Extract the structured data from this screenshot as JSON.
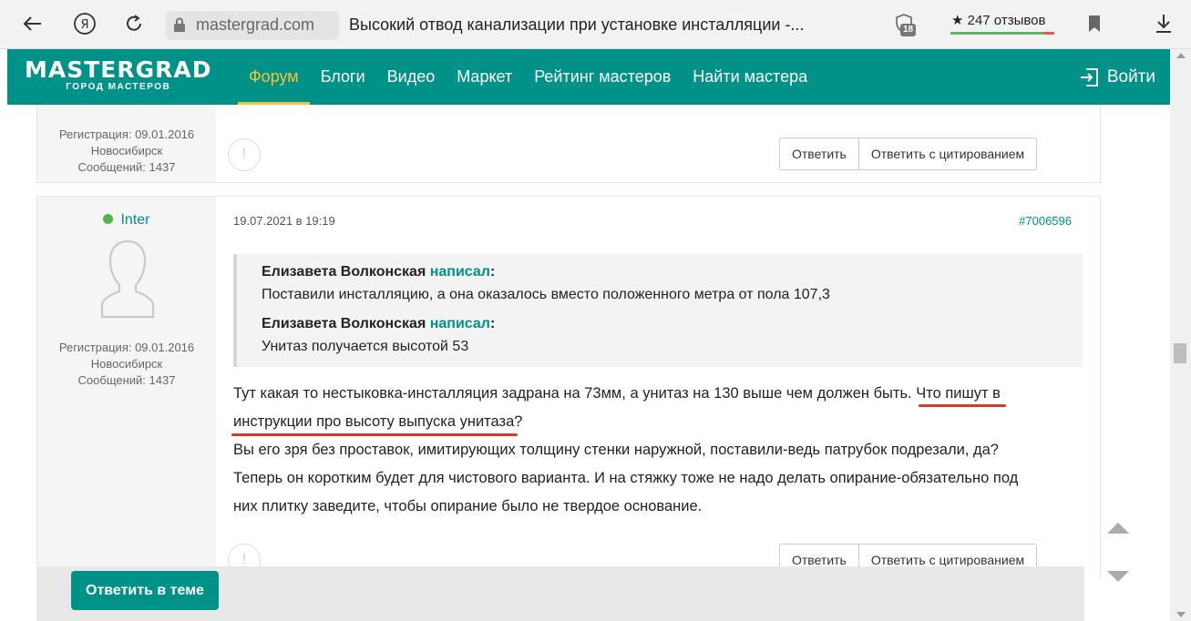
{
  "browser": {
    "domain": "mastergrad.com",
    "title": "Высокий отвод канализации при установке инсталляции -...",
    "shield_badge": "18",
    "reviews": "★ 247 отзывов"
  },
  "site": {
    "logo_main": "MASTERGRAD",
    "logo_sub": "ГОРОД МАСТЕРОВ",
    "nav": [
      "Форум",
      "Блоги",
      "Видео",
      "Маркет",
      "Рейтинг мастеров",
      "Найти мастера"
    ],
    "login": "Войти"
  },
  "prev_post": {
    "registration": "Регистрация: 09.01.2016",
    "city": "Новосибирск",
    "messages": "Сообщений: 1437",
    "reply": "Ответить",
    "reply_quote": "Ответить с цитированием"
  },
  "post": {
    "username": "Inter",
    "registration": "Регистрация: 09.01.2016",
    "city": "Новосибирск",
    "messages": "Сообщений: 1437",
    "date": "19.07.2021 в 19:19",
    "number": "#7006596",
    "quotes": [
      {
        "author": "Елизавета Волконская",
        "wrote": "написал",
        "colon": ":",
        "text": "Поставили инсталляцию, а она оказалось вместо положенного метра от пола 107,3"
      },
      {
        "author": "Елизавета Волконская",
        "wrote": "написал",
        "colon": ":",
        "text": "Унитаз получается высотой 53"
      }
    ],
    "body": {
      "line1_start": "Тут какая то нестыковка-инсталляция задрана на 73мм, а унитаз на 130 выше чем должен быть. ",
      "line1_hl": "Что пишут в",
      "line2_hl": "инструкции про высоту выпуска унитаза",
      "line2_end": "?",
      "line3": "Вы его зря без проставок, имитирующих толщину стенки наружной, поставили-ведь патрубок подрезали, да?",
      "line4": "Теперь он коротким будет для чистового варианта. И на стяжку тоже не надо делать опирание-обязательно под",
      "line5": "них плитку заведите, чтобы опирание было не твердое основание."
    },
    "reply": "Ответить",
    "reply_quote": "Ответить с цитированием"
  },
  "reply_bar": {
    "button": "Ответить в теме"
  },
  "colors": {
    "brand": "#009288",
    "nav_active": "#f3c53d",
    "online": "#4cb848",
    "annotation": "#d83a2b"
  }
}
